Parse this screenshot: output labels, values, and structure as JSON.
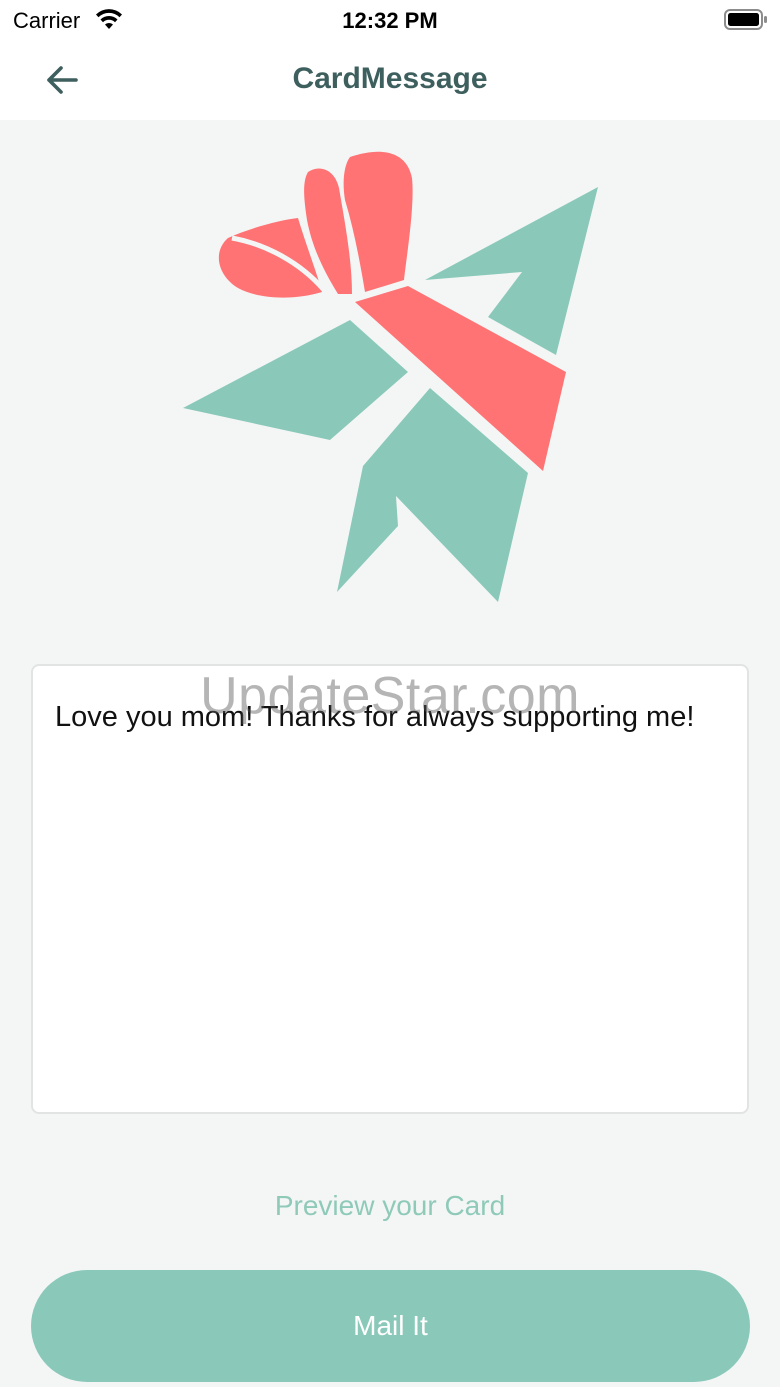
{
  "status_bar": {
    "carrier": "Carrier",
    "time": "12:32 PM",
    "icons": [
      "wifi-icon",
      "battery-icon"
    ]
  },
  "nav": {
    "back_icon": "arrow-left-icon",
    "title": "CardMessage"
  },
  "logo": {
    "description_icon": "gift-plane-logo",
    "colors": {
      "teal": "#8ac9b9",
      "coral": "#ff7375"
    }
  },
  "message": {
    "value": "Love you mom! Thanks for always supporting me!"
  },
  "watermark": {
    "text": "UpdateStar.com"
  },
  "actions": {
    "preview_label": "Preview your Card",
    "mail_label": "Mail It"
  },
  "colors": {
    "background": "#f4f6f5",
    "accent": "#8ac9b9",
    "title": "#3d5f5d",
    "coral": "#ff7375"
  }
}
